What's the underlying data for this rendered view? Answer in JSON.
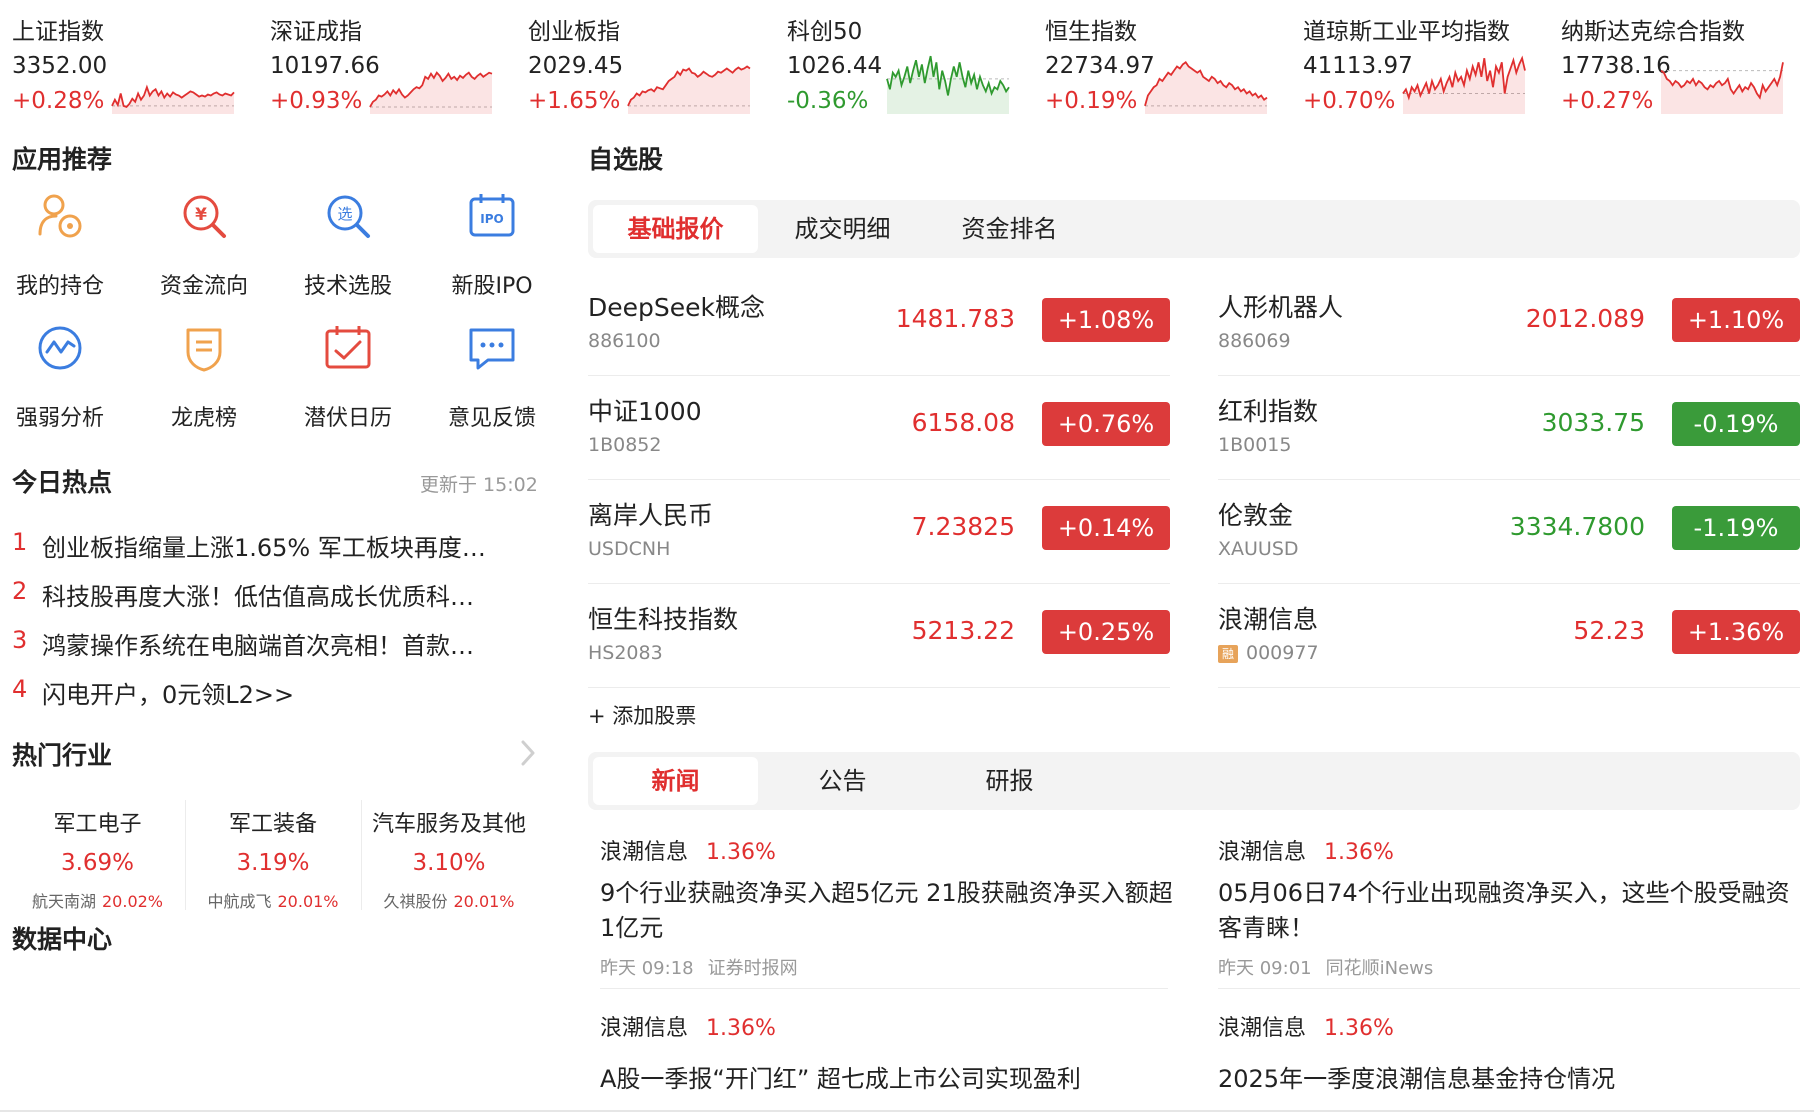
{
  "indices": [
    {
      "name": "上证指数",
      "value": "3352.00",
      "change": "+0.28%",
      "direction": "up",
      "spark": [
        2,
        8,
        3,
        14,
        2,
        1,
        4,
        9,
        6,
        14,
        8,
        12,
        20,
        12,
        16,
        18,
        12,
        16,
        10,
        14,
        11,
        15,
        13,
        12,
        10,
        12,
        14,
        16,
        15,
        13,
        11,
        12,
        11,
        13,
        12,
        14,
        15,
        13,
        12,
        14,
        13,
        12,
        15
      ]
    },
    {
      "name": "深证成指",
      "value": "10197.66",
      "change": "+0.93%",
      "direction": "up",
      "spark": [
        1,
        6,
        8,
        12,
        11,
        13,
        16,
        12,
        17,
        14,
        18,
        13,
        10,
        12,
        15,
        18,
        20,
        19,
        22,
        30,
        28,
        33,
        29,
        34,
        31,
        26,
        29,
        33,
        28,
        30,
        27,
        31,
        29,
        32,
        34,
        30,
        28,
        31,
        33,
        30,
        32,
        34,
        33
      ]
    },
    {
      "name": "创业板指",
      "value": "2029.45",
      "change": "+1.65%",
      "direction": "up",
      "spark": [
        2,
        8,
        10,
        14,
        12,
        16,
        15,
        17,
        18,
        16,
        20,
        19,
        18,
        22,
        26,
        28,
        30,
        35,
        32,
        37,
        36,
        38,
        34,
        33,
        30,
        32,
        35,
        33,
        31,
        30,
        32,
        35,
        34,
        36,
        38,
        36,
        34,
        37,
        39,
        37,
        38,
        40,
        38
      ]
    },
    {
      "name": "科创50",
      "value": "1026.44",
      "change": "-0.36%",
      "direction": "down",
      "spark": [
        28,
        18,
        34,
        30,
        36,
        22,
        30,
        40,
        24,
        36,
        46,
        30,
        42,
        24,
        38,
        50,
        30,
        44,
        18,
        36,
        26,
        12,
        28,
        40,
        30,
        44,
        30,
        20,
        36,
        24,
        32,
        18,
        30,
        22,
        16,
        24,
        14,
        20,
        18,
        26,
        22,
        16,
        20
      ]
    },
    {
      "name": "恒生指数",
      "value": "22734.97",
      "change": "+0.19%",
      "direction": "up",
      "spark": [
        2,
        12,
        16,
        20,
        22,
        28,
        26,
        30,
        34,
        32,
        36,
        40,
        38,
        42,
        44,
        40,
        38,
        36,
        34,
        36,
        30,
        28,
        26,
        30,
        28,
        24,
        26,
        22,
        20,
        24,
        22,
        18,
        20,
        16,
        18,
        14,
        16,
        12,
        14,
        10,
        12,
        8,
        10
      ]
    },
    {
      "name": "道琼斯工业平均指数",
      "value": "41113.97",
      "change": "+0.70%",
      "direction": "up",
      "spark": [
        14,
        18,
        10,
        20,
        16,
        22,
        12,
        18,
        24,
        14,
        26,
        18,
        22,
        28,
        16,
        24,
        30,
        20,
        34,
        26,
        30,
        22,
        36,
        28,
        40,
        32,
        44,
        30,
        48,
        26,
        36,
        20,
        40,
        34,
        44,
        14,
        30,
        38,
        46,
        34,
        42,
        48,
        36
      ]
    },
    {
      "name": "纳斯达克综合指数",
      "value": "17738.16",
      "change": "+0.27%",
      "direction": "up",
      "spark": [
        36,
        34,
        28,
        26,
        22,
        26,
        24,
        20,
        22,
        26,
        24,
        28,
        22,
        26,
        24,
        20,
        18,
        22,
        20,
        24,
        26,
        22,
        24,
        28,
        18,
        14,
        18,
        22,
        16,
        20,
        18,
        24,
        20,
        14,
        10,
        22,
        16,
        20,
        24,
        28,
        22,
        30,
        44
      ]
    }
  ],
  "apps": {
    "title": "应用推荐",
    "items": [
      {
        "label": "我的持仓",
        "icon": "holdings-icon",
        "color": "#f0a24d"
      },
      {
        "label": "资金流向",
        "icon": "capital-flow-icon",
        "color": "#e44b3f"
      },
      {
        "label": "技术选股",
        "icon": "stock-screener-icon",
        "color": "#3b7de0"
      },
      {
        "label": "新股IPO",
        "icon": "ipo-icon",
        "color": "#3b7de0"
      },
      {
        "label": "强弱分析",
        "icon": "strength-analysis-icon",
        "color": "#3b7de0"
      },
      {
        "label": "龙虎榜",
        "icon": "dragon-tiger-icon",
        "color": "#f0a24d"
      },
      {
        "label": "潜伏日历",
        "icon": "calendar-icon",
        "color": "#e44b3f"
      },
      {
        "label": "意见反馈",
        "icon": "feedback-icon",
        "color": "#3b7de0"
      }
    ]
  },
  "hot": {
    "title": "今日热点",
    "updated": "更新于 15:02",
    "items": [
      {
        "rank": "1",
        "text": "创业板指缩量上涨1.65% 军工板块再度…"
      },
      {
        "rank": "2",
        "text": "科技股再度大涨！低估值高成长优质科…"
      },
      {
        "rank": "3",
        "text": "鸿蒙操作系统在电脑端首次亮相！首款…"
      },
      {
        "rank": "4",
        "text": "闪电开户，0元领L2>>"
      }
    ]
  },
  "industries": {
    "title": "热门行业",
    "items": [
      {
        "name": "军工电子",
        "pct": "3.69%",
        "leader": "航天南湖",
        "leader_pct": "20.02%"
      },
      {
        "name": "军工装备",
        "pct": "3.19%",
        "leader": "中航成飞",
        "leader_pct": "20.01%"
      },
      {
        "name": "汽车服务及其他",
        "pct": "3.10%",
        "leader": "久祺股份",
        "leader_pct": "20.01%"
      }
    ]
  },
  "data_center": {
    "title": "数据中心"
  },
  "watchlist": {
    "title": "自选股",
    "tabs": [
      "基础报价",
      "成交明细",
      "资金排名"
    ],
    "active_tab": 0,
    "add_label": "+ 添加股票",
    "items": [
      {
        "name": "DeepSeek概念",
        "code": "886100",
        "price": "1481.783",
        "change": "+1.08%",
        "direction": "up",
        "margin": false
      },
      {
        "name": "人形机器人",
        "code": "886069",
        "price": "2012.089",
        "change": "+1.10%",
        "direction": "up",
        "margin": false
      },
      {
        "name": "中证1000",
        "code": "1B0852",
        "price": "6158.08",
        "change": "+0.76%",
        "direction": "up",
        "margin": false
      },
      {
        "name": "红利指数",
        "code": "1B0015",
        "price": "3033.75",
        "change": "-0.19%",
        "direction": "down",
        "margin": false
      },
      {
        "name": "离岸人民币",
        "code": "USDCNH",
        "price": "7.23825",
        "change": "+0.14%",
        "direction": "up",
        "margin": false
      },
      {
        "name": "伦敦金",
        "code": "XAUUSD",
        "price": "3334.7800",
        "change": "-1.19%",
        "direction": "down",
        "margin": false
      },
      {
        "name": "恒生科技指数",
        "code": "HS2083",
        "price": "5213.22",
        "change": "+0.25%",
        "direction": "up",
        "margin": false
      },
      {
        "name": "浪潮信息",
        "code": "000977",
        "price": "52.23",
        "change": "+1.36%",
        "direction": "up",
        "margin": true,
        "margin_label": "融"
      }
    ]
  },
  "news": {
    "tabs": [
      "新闻",
      "公告",
      "研报"
    ],
    "active_tab": 0,
    "items": [
      {
        "stock": "浪潮信息",
        "pct": "1.36%",
        "title": "9个行业获融资净买入超5亿元 21股获融资净买入额超1亿元",
        "time": "昨天 09:18",
        "source": "证券时报网"
      },
      {
        "stock": "浪潮信息",
        "pct": "1.36%",
        "title": "05月06日74个行业出现融资净买入，这些个股受融资客青睐！",
        "time": "昨天 09:01",
        "source": "同花顺iNews"
      },
      {
        "stock": "浪潮信息",
        "pct": "1.36%",
        "title": "A股一季报“开门红” 超七成上市公司实现盈利",
        "time": "",
        "source": ""
      },
      {
        "stock": "浪潮信息",
        "pct": "1.36%",
        "title": "2025年一季度浪潮信息基金持仓情况",
        "time": "",
        "source": ""
      }
    ]
  },
  "colors": {
    "up": "#e02f2f",
    "down": "#2f9a2f",
    "accent": "#e02f2f"
  }
}
